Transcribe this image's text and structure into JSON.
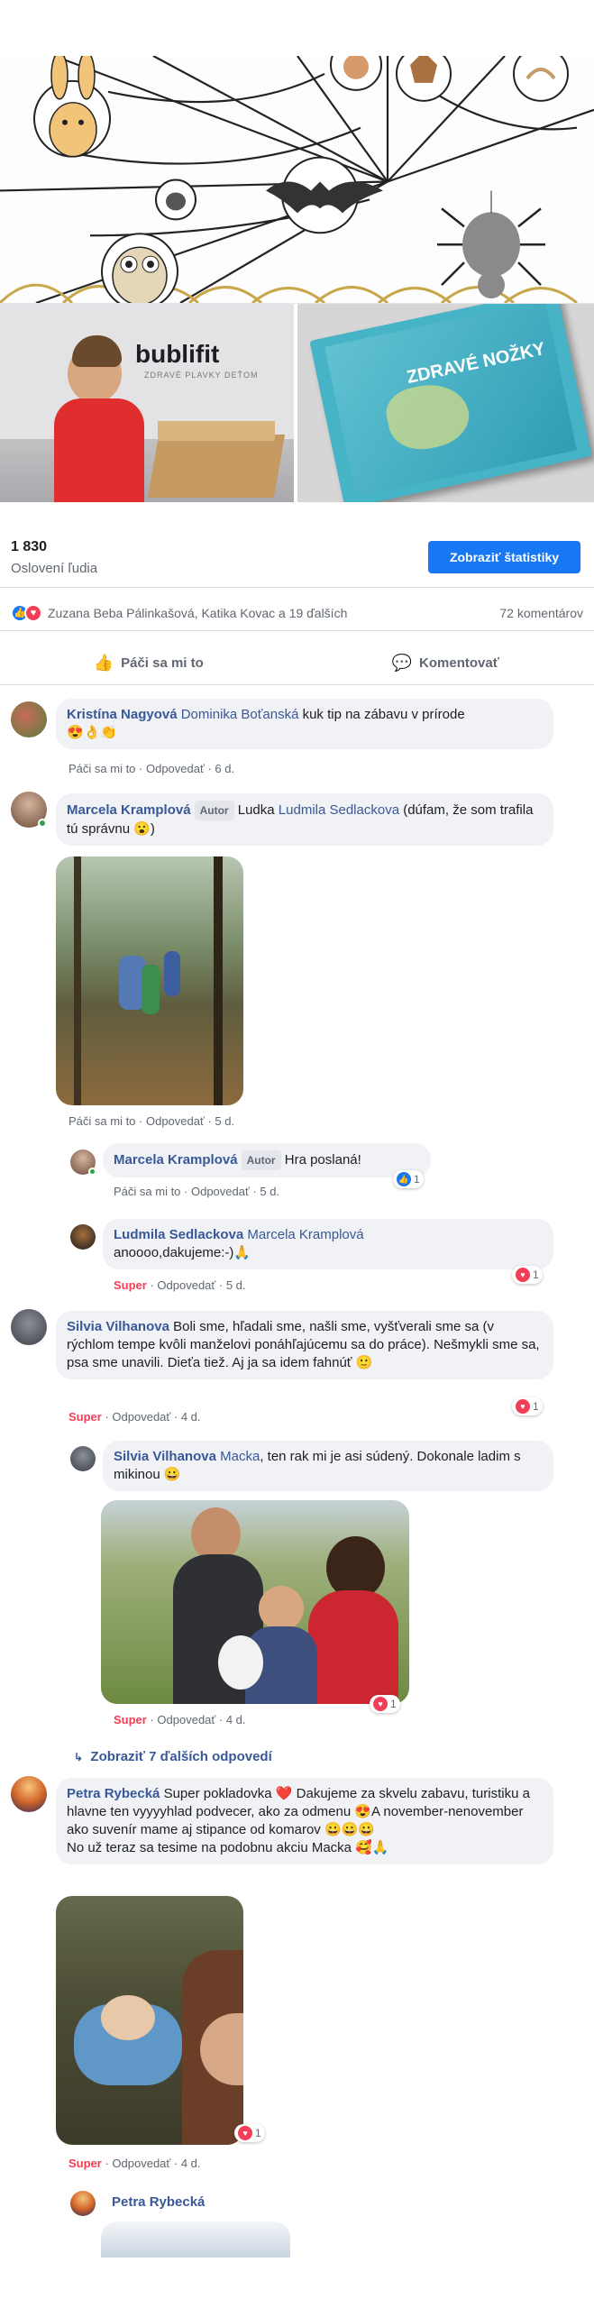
{
  "post": {
    "stats": {
      "reach": "1 830",
      "reach_label": "Oslovení ľudia",
      "button": "Zobraziť štatistiky"
    },
    "reactions": {
      "names": "Zuzana Beba Pálinkašová, Katika Kovac a 19 ďalších",
      "comments": "72 komentárov"
    },
    "actions": {
      "like": "Páči sa mi to",
      "comment": "Komentovať"
    },
    "hero_logo": "bublifit",
    "hero_tagline": "ZDRAVÉ PLAVKY DEŤOM",
    "book_title": "ZDRAVÉ NOŽKY"
  },
  "comments": [
    {
      "author": "Kristína Nagyová",
      "mention": "Dominika Boťanská",
      "text": " kuk tip na zábavu v prírode",
      "emoji": "😍👌👏",
      "like": "Páči sa mi to",
      "reply": "Odpovedať",
      "time": "6 d."
    },
    {
      "author": "Marcela Kramplová",
      "badge": "Autor",
      "text_pre": " Ludka ",
      "mention": "Ludmila Sedlackova",
      "text": " (dúfam, že som trafila tú správnu 😮)",
      "like": "Páči sa mi to",
      "reply": "Odpovedať",
      "time": "5 d.",
      "replies": [
        {
          "author": "Marcela Kramplová",
          "badge": "Autor",
          "text": " Hra poslaná!",
          "like": "Páči sa mi to",
          "reply": "Odpovedať",
          "time": "5 d.",
          "reactions": "1"
        },
        {
          "author": "Ludmila Sedlackova",
          "mention": "Marcela Kramplová",
          "text": "anoooo,dakujeme:-)🙏",
          "reaction_label": "Super",
          "reply": "Odpovedať",
          "time": "5 d.",
          "reactions": "1"
        }
      ]
    },
    {
      "author": "Silvia Vilhanova",
      "text": " Boli sme, hľadali sme, našli sme, vyšťverali sme sa (v rýchlom tempe kvôli manželovi ponáhľajúcemu sa do práce). Nešmykli sme sa, psa sme unavili. Dieťa tiež. Aj ja sa idem fahnúť 🙂",
      "reaction_label": "Super",
      "reply": "Odpovedať",
      "time": "4 d.",
      "reactions": "1",
      "replies": [
        {
          "author": "Silvia Vilhanova",
          "mention": "Macka",
          "text": ", ten rak mi je asi súdený. Dokonale ladim s mikinou 😀",
          "reaction_label": "Super",
          "reply": "Odpovedať",
          "time": "4 d.",
          "reactions": "1"
        }
      ],
      "more_replies": "Zobraziť 7 ďalších odpovedí"
    },
    {
      "author": "Petra Rybecká",
      "text": " Super pokladovka ❤️ Dakujeme za skvelu zabavu, turistiku a hlavne ten vyyyyhlad podvecer, ako za odmenu 😍A november-nenovember ako suvenír mame aj stipance od komarov 😀😀😀",
      "text2": "No už teraz sa tesime na podobnu akciu Macka 🥰🙏",
      "reaction_label": "Super",
      "reply": "Odpovedať",
      "time": "4 d.",
      "reactions": "1",
      "replies": [
        {
          "author": "Petra Rybecká"
        }
      ]
    }
  ],
  "colors": {
    "accent": "#1877f2",
    "link": "#385898",
    "love": "#f33e58",
    "muted": "#606770",
    "bubble": "#f0f2f5"
  }
}
